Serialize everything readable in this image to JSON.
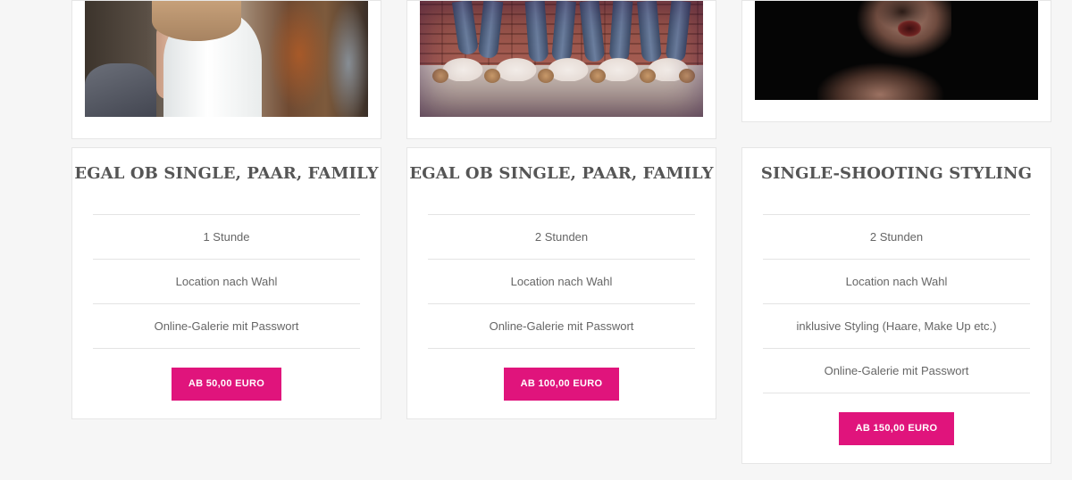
{
  "colors": {
    "accent": "#e0147c",
    "page_background": "#f6f6f6",
    "card_background": "#ffffff",
    "title_text": "#555555",
    "body_text": "#666666"
  },
  "packages": [
    {
      "title": "EGAL OB SINGLE, PAAR, FAMILY",
      "features": [
        "1 Stunde",
        "Location nach Wahl",
        "Online-Galerie mit Passwort"
      ],
      "button": "AB 50,00 EURO"
    },
    {
      "title": "EGAL OB SINGLE, PAAR, FAMILY",
      "features": [
        "2 Stunden",
        "Location nach Wahl",
        "Online-Galerie mit Passwort"
      ],
      "button": "AB 100,00 EURO"
    },
    {
      "title": "SINGLE-SHOOTING STYLING",
      "features": [
        "2 Stunden",
        "Location nach Wahl",
        "inklusive Styling (Haare, Make Up etc.)",
        "Online-Galerie mit Passwort"
      ],
      "button": "AB 150,00 EURO"
    }
  ]
}
